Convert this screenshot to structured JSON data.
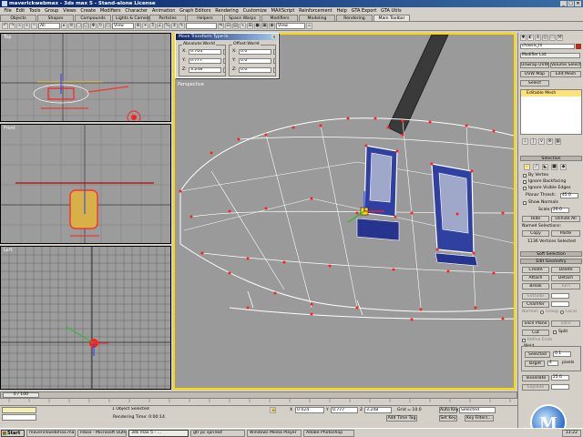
{
  "window": {
    "title": "maverickwebmax - 3ds max 5 - Stand-alone License"
  },
  "menu": [
    "File",
    "Edit",
    "Tools",
    "Group",
    "Views",
    "Create",
    "Modifiers",
    "Character",
    "Animation",
    "Graph Editors",
    "Rendering",
    "Customize",
    "MAXScript",
    "Reinforcement",
    "Help",
    "GTA Export",
    "GTA Utils"
  ],
  "tabs": [
    "Objects",
    "Shapes",
    "Compounds",
    "Lights & Cameras",
    "Particles",
    "Helpers",
    "Space Warps",
    "Modifiers",
    "Modeling",
    "Rendering",
    "Main Toolbar"
  ],
  "toolbar": {
    "selection_filter": "All",
    "coord_system": "View",
    "named_sel": "",
    "view_dropdown": "View"
  },
  "dialog": {
    "title": "Move Transform Type-In",
    "absolute_label": "Absolute:World",
    "offset_label": "Offset:World",
    "abs": {
      "x": "0.704",
      "y": "0.777",
      "z": "3.248"
    },
    "off": {
      "x": "0.0",
      "y": "0.0",
      "z": "0.0"
    }
  },
  "panel": {
    "object_name": "chassis_hi",
    "modifier_list": "Modifier List",
    "btn_unwrap": "Unwrap UVW",
    "btn_volume": "Volume Select",
    "btn_uvw": "UVW Map",
    "btn_edit_mesh": "Edit Mesh",
    "btn_select": "Select",
    "stack_item": "Editable Mesh",
    "rollout_selection": "Selection",
    "by_vertex": "By Vertex",
    "ignore_backfacing": "Ignore Backfacing",
    "ignore_visible_edges": "Ignore Visible Edges",
    "planar_thresh_label": "Planar Thresh:",
    "planar_thresh_val": "45.0",
    "show_normals": "Show Normals",
    "scale_label": "Scale:",
    "scale_val": "20.0",
    "hide": "Hide",
    "unhide_all": "Unhide All",
    "named_selections": "Named Selections:",
    "copy": "Copy",
    "paste": "Paste",
    "selected_count": "1136 Vertices Selected",
    "rollout_soft": "Soft Selection",
    "rollout_edit": "Edit Geometry",
    "create": "Create",
    "delete": "Delete",
    "attach": "Attach",
    "detach": "Detach",
    "break": "Break",
    "turn": "Turn",
    "extrude_label": "Extrude",
    "chamfer_label": "Chamfer",
    "normal_label": "Normal:",
    "group_label": "Group",
    "local_label": "Local",
    "slice_plane": "Slice Plane",
    "split": "Split",
    "cut": "Cut",
    "refine_ends": "Refine Ends",
    "weld_label": "Weld",
    "weld_selected": "Selected",
    "weld_selected_val": "0.1",
    "weld_target": "Target",
    "weld_target_val": "4",
    "weld_pixels": "pixels",
    "tessellate": "Tessellate",
    "tess_val": "25.0"
  },
  "viewports": {
    "top": "Top",
    "front": "Front",
    "left": "Left",
    "persp": "Perspective"
  },
  "timeline": {
    "frame": "0 / 100"
  },
  "status": {
    "selected": "1 Object Selected",
    "rendering_time": "Rendering Time: 0:00:14",
    "x_label": "X",
    "x_val": "0.024",
    "y_label": "Y",
    "y_val": "0.777",
    "z_label": "Z",
    "z_val": "3.248",
    "grid": "Grid = 10.0",
    "add_time_tag": "Add Time Tag",
    "auto_key": "Auto Key",
    "key_mode": "Selected",
    "set_key": "Set Key",
    "key_filters": "Key Filters..."
  },
  "taskbar": {
    "start": "Start",
    "tasks": [
      "maverickwebmax.max - 3...",
      "Inbox - Microsoft Outlook",
      "3ds max 5 - ...",
      "gtr pc sprinkit",
      "Windows Media Player",
      "Adobe Photoshop"
    ],
    "clock": "13:22"
  },
  "logo_letter": "M",
  "colors": {
    "viewport": "#9c9c9c",
    "mesh": "#ffffff",
    "vertex": "#ff2020",
    "selected_frame": "#ffd800"
  }
}
